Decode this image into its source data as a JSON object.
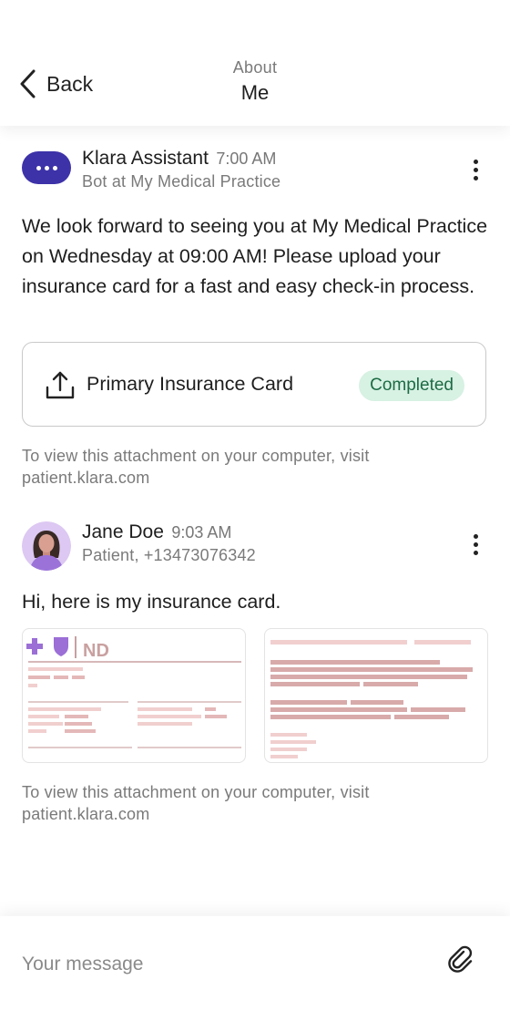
{
  "header": {
    "back_label": "Back",
    "about_label": "About",
    "title": "Me"
  },
  "messages": [
    {
      "sender": "Klara Assistant",
      "time": "7:00 AM",
      "subtitle": "Bot at My Medical Practice",
      "text": "We look forward to seeing you at My Medical Practice on Wednesday at 09:00 AM! Please upload your insurance card for a fast and easy check-in process.",
      "attachment": {
        "icon": "upload-icon",
        "label": "Primary Insurance Card",
        "status": "Completed"
      },
      "hint": "To view this attachment on your computer, visit patient.klara.com"
    },
    {
      "sender": "Jane Doe",
      "time": "9:03 AM",
      "subtitle": "Patient, +13473076342",
      "text": "Hi, here is my insurance card.",
      "card_logo_text": "ND",
      "hint": "To view this attachment on your computer, visit patient.klara.com"
    }
  ],
  "composer": {
    "placeholder": "Your message",
    "attach_icon": "paperclip-icon"
  },
  "colors": {
    "bot_accent": "#3d32a8",
    "badge_bg": "#d7f1e3",
    "badge_text": "#1d6b44",
    "card_accent": "#9b6fd6"
  }
}
